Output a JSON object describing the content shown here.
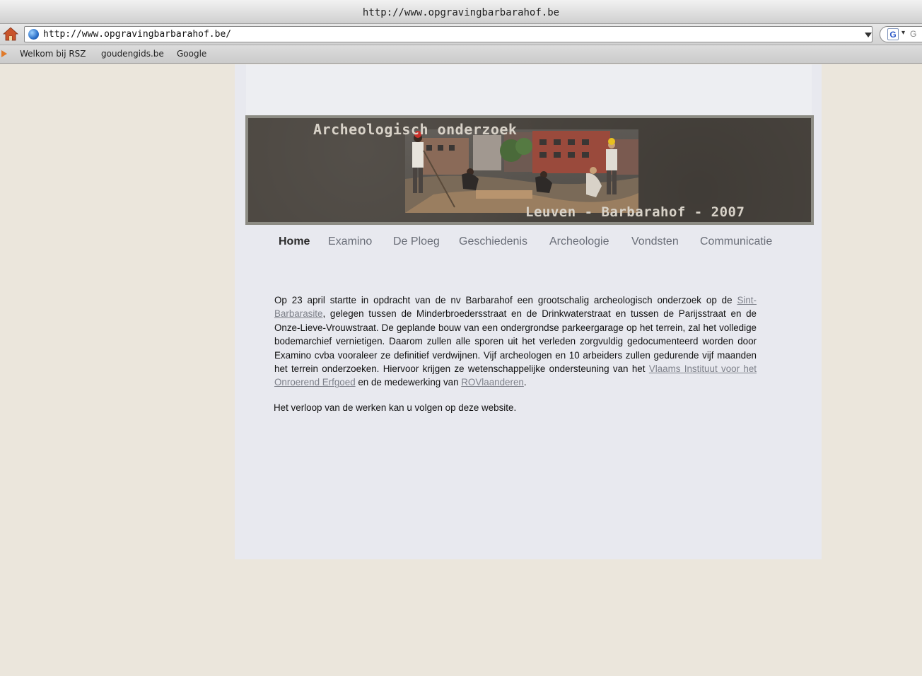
{
  "browser": {
    "title": "http://www.opgravingbarbarahof.be",
    "url": "http://www.opgravingbarbarahof.be/",
    "search_logo": "G",
    "bookmarks": [
      "Welkom bij RSZ",
      "goudengids.be",
      "Google"
    ]
  },
  "site": {
    "banner_title": "Archeologisch onderzoek",
    "banner_subtitle": "Leuven - Barbarahof - 2007",
    "nav": [
      {
        "label": "Home",
        "active": true
      },
      {
        "label": "Examino",
        "active": false
      },
      {
        "label": "De Ploeg",
        "active": false
      },
      {
        "label": "Geschiedenis",
        "active": false
      },
      {
        "label": "Archeologie",
        "active": false
      },
      {
        "label": "Vondsten",
        "active": false
      },
      {
        "label": "Communicatie",
        "active": false
      }
    ],
    "content": {
      "text_1": "Op 23 april startte in opdracht van de nv Barbarahof een grootschalig archeologisch onderzoek op de ",
      "link_1": "Sint-Barbarasite",
      "text_2": ", gelegen tussen de Minderbroedersstraat en de Drinkwaterstraat en tussen de Parijsstraat en de Onze-Lieve-Vrouwstraat. De geplande bouw van een ondergrondse parkeergarage op het terrein, zal het volledige bodemarchief vernietigen. Daarom zullen alle sporen uit het verleden zorgvuldig gedocumenteerd worden door Examino cvba vooraleer ze definitief verdwijnen. Vijf archeologen en 10 arbeiders zullen gedurende vijf maanden het terrein onderzoeken. Hiervoor krijgen ze wetenschappelijke ondersteuning van het ",
      "link_2": "Vlaams Instituut voor het Onroerend Erfgoed",
      "text_3": " en de medewerking van ",
      "link_3": "ROVlaanderen",
      "text_4": ".",
      "paragraph_2": "Het verloop van de werken kan u volgen op deze website."
    },
    "colors": {
      "banner_bg": "#4b4640",
      "banner_border": "#8d8c84",
      "nav_active": "#2a2a2a",
      "nav_inactive": "#6a6e78",
      "link": "#7d8089"
    }
  }
}
